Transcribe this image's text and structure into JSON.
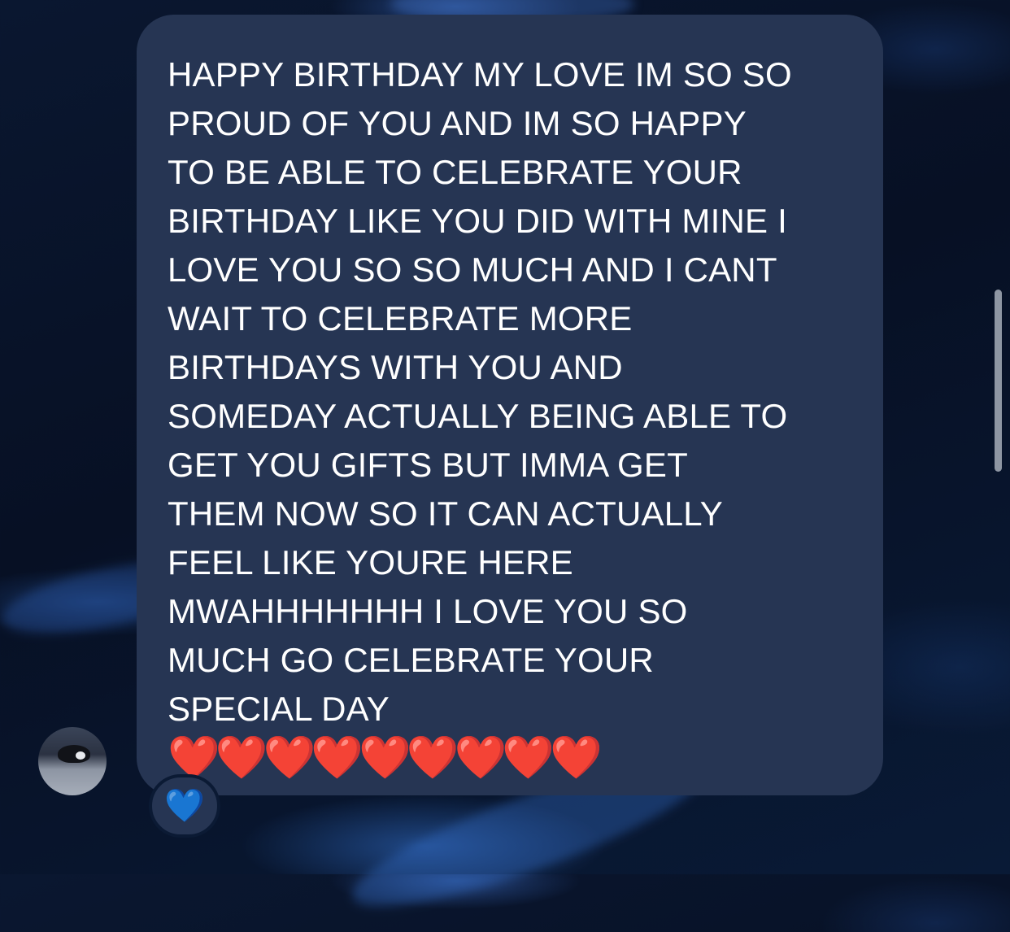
{
  "conversation": {
    "message": {
      "text": "HAPPY BIRTHDAY MY LOVE IM SO SO\nPROUD OF YOU AND IM SO HAPPY\nTO BE ABLE TO CELEBRATE YOUR\nBIRTHDAY LIKE YOU DID WITH MINE I\nLOVE YOU SO SO MUCH AND I CANT\nWAIT TO CELEBRATE MORE\nBIRTHDAYS WITH YOU AND\nSOMEDAY ACTUALLY BEING ABLE TO\nGET YOU GIFTS BUT IMMA GET\nTHEM NOW SO IT CAN ACTUALLY\nFEEL LIKE YOURE HERE\nMWAHHHHHHH I LOVE YOU SO\nMUCH GO CELEBRATE YOUR\nSPECIAL DAY",
      "emoji": "❤️❤️❤️❤️❤️❤️❤️❤️❤️",
      "bubble_color": "#263553"
    },
    "reaction": {
      "emoji": "💙",
      "color": "#1e7bff"
    },
    "sender_avatar": {
      "icon": "cat-avatar-icon"
    }
  },
  "colors": {
    "background": "#071024",
    "text": "#ffffff",
    "heart": "#d0141b"
  }
}
